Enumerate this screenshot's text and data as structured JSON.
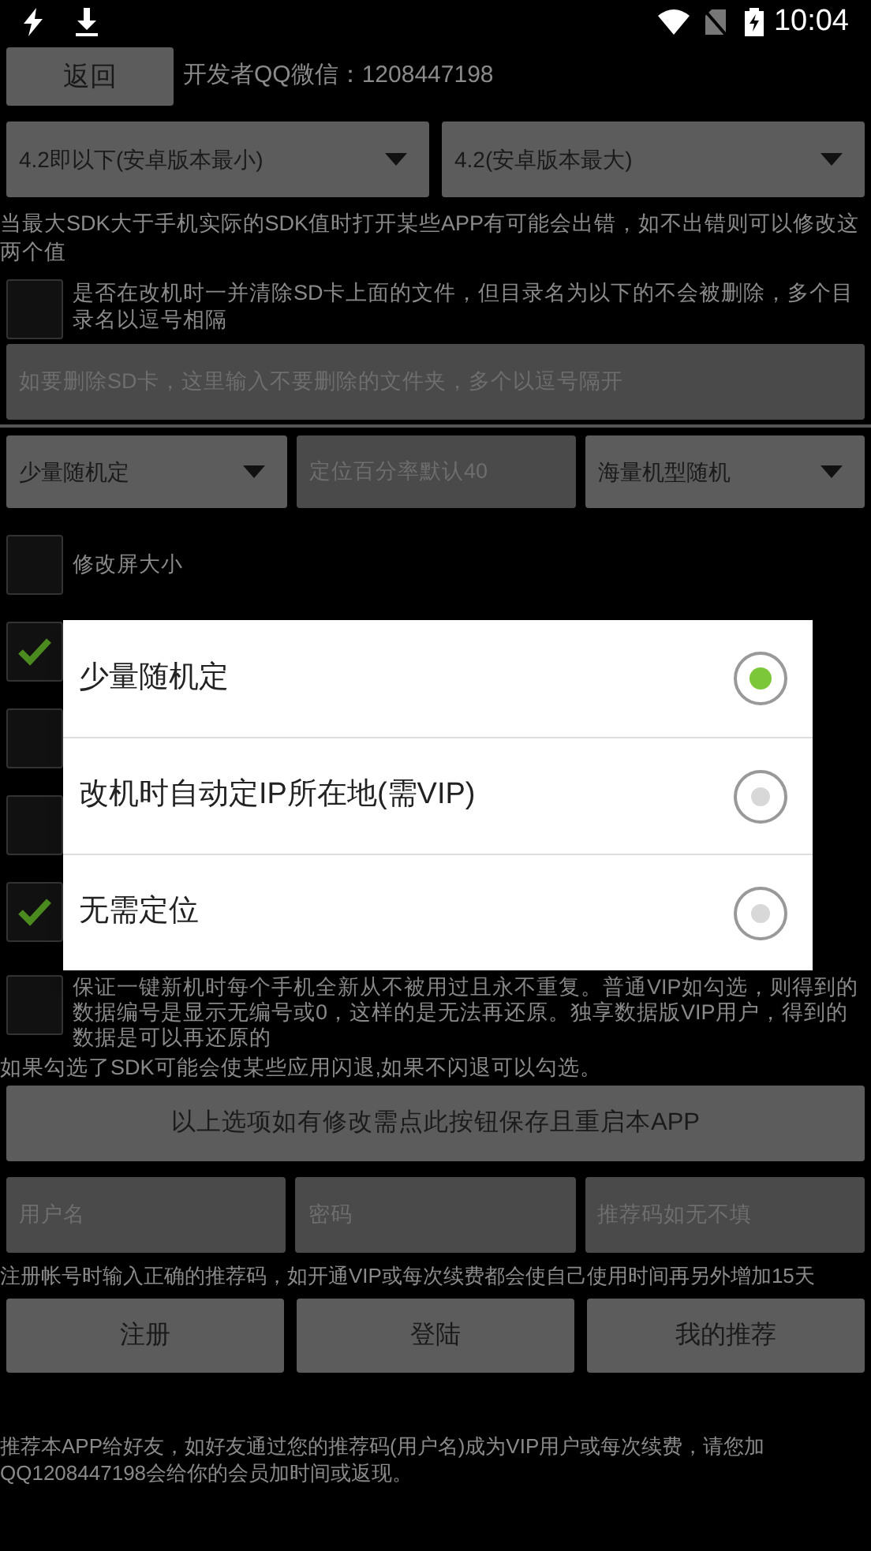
{
  "status_bar": {
    "time": "10:04"
  },
  "back_button": "返回",
  "developer_contact": "开发者QQ微信：1208447198",
  "version_dropdowns": [
    {
      "value": "4.2即以下(安卓版本最小)"
    },
    {
      "value": "4.2(安卓版本最大)"
    }
  ],
  "sdk_note": "当最大SDK大于手机实际的SDK值时打开某些APP有可能会出错，如不出错则可以修改这两个值",
  "clear_sd": {
    "label": "是否在改机时一并清除SD卡上面的文件，但目录名为以下的不会被删除，多个目录名以逗号相隔",
    "checked": false
  },
  "exclude_field": {
    "placeholder": "如要删除SD卡，这里输入不要删除的文件夹，多个以逗号隔开"
  },
  "location_row": {
    "mode_dropdown": "少量随机定",
    "percent_field": {
      "placeholder": "定位百分率默认40"
    },
    "model_dropdown": "海量机型随机"
  },
  "options": [
    {
      "label": "修改屏大小",
      "checked": false
    },
    {
      "checked": true
    },
    {
      "checked": false
    },
    {
      "checked": false
    },
    {
      "checked": true
    },
    {
      "label": "保证一键新机时每个手机全新从不被用过且永不重复。普通VIP如勾选，则得到的数据编号是显示无编号或0，这样的是无法再还原。独享数据版VIP用户，得到的数据是可以再还原的",
      "checked": false
    }
  ],
  "crash_note": "如果勾选了SDK可能会使某些应用闪退,如果不闪退可以勾选。",
  "save_button": "以上选项如有修改需点此按钮保存且重启本APP",
  "account_fields": [
    {
      "placeholder": "用户名"
    },
    {
      "placeholder": "密码"
    },
    {
      "placeholder": "推荐码如无不填"
    }
  ],
  "referral_note": "注册帐号时输入正确的推荐码，如开通VIP或每次续费都会使自己使用时间再另外增加15天",
  "account_buttons": [
    "注册",
    "登陆",
    "我的推荐"
  ],
  "footer_note": "推荐本APP给好友，如好友通过您的推荐码(用户名)成为VIP用户或每次续费，请您加QQ1208447198会给你的会员加时间或返现。",
  "dialog": {
    "options": [
      {
        "label": "少量随机定",
        "selected": true
      },
      {
        "label": "改机时自动定IP所在地(需VIP)",
        "selected": false
      },
      {
        "label": "无需定位",
        "selected": false
      }
    ]
  }
}
